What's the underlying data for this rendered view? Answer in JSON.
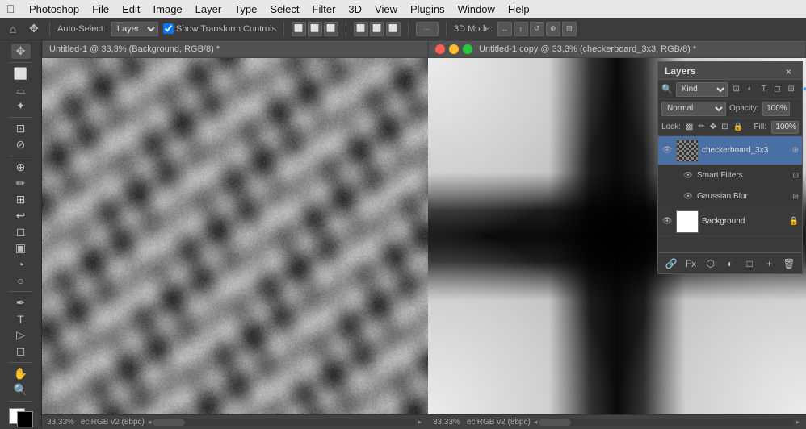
{
  "menubar": {
    "app_name": "Photoshop",
    "menus": [
      "File",
      "Edit",
      "Image",
      "Layer",
      "Type",
      "Select",
      "Filter",
      "3D",
      "View",
      "Plugins",
      "Window",
      "Help"
    ]
  },
  "options_bar": {
    "tool_label": "Auto-Select:",
    "tool_select": "Layer",
    "transform_label": "Show Transform Controls",
    "align_btns": [
      "left-align",
      "center-align",
      "right-align",
      "top-align",
      "middle-align",
      "bottom-align"
    ],
    "more_icon": "...",
    "mode_label": "3D Mode:"
  },
  "doc1": {
    "title": "Untitled-1 @ 33,3% (Background, RGB/8) *",
    "zoom": "33,33%",
    "color": "eciRGB v2 (8bpc)"
  },
  "doc2": {
    "title": "Untitled-1 copy @ 33,3% (checkerboard_3x3, RGB/8) *",
    "zoom": "33,33%",
    "color": "eciRGB v2 (8bpc)"
  },
  "layers_panel": {
    "title": "Layers",
    "close_icon": "×",
    "kind_label": "Kind",
    "blend_mode": "Normal",
    "opacity_label": "Opacity:",
    "opacity_value": "100%",
    "lock_label": "Lock:",
    "fill_label": "Fill:",
    "fill_value": "100%",
    "layers": [
      {
        "name": "checkerboard_3x3",
        "type": "smart-object",
        "visible": true,
        "selected": true,
        "has_fx": true
      },
      {
        "name": "Smart Filters",
        "type": "smart-filters-group",
        "visible": true,
        "indent": true
      },
      {
        "name": "Gaussian Blur",
        "type": "smart-filter",
        "visible": true,
        "indent": true
      },
      {
        "name": "Background",
        "type": "background",
        "visible": true,
        "locked": true
      }
    ],
    "bottom_icons": [
      "fx",
      "mask",
      "adjustment",
      "group",
      "new-layer",
      "delete"
    ]
  }
}
